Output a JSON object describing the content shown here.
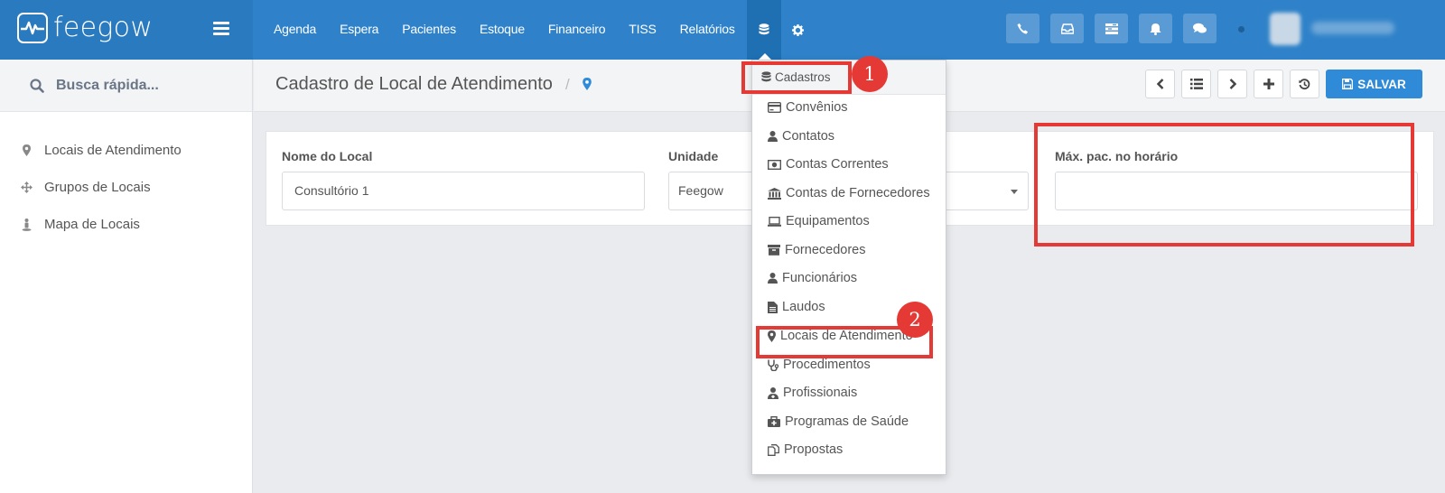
{
  "brand": {
    "name": "feegow"
  },
  "nav": {
    "items": [
      "Agenda",
      "Espera",
      "Pacientes",
      "Estoque",
      "Financeiro",
      "TISS",
      "Relatórios"
    ]
  },
  "sidebar": {
    "search_label": "Busca rápida...",
    "items": [
      {
        "label": "Locais de Atendimento",
        "icon": "map-marker-icon"
      },
      {
        "label": "Grupos de Locais",
        "icon": "arrows-icon"
      },
      {
        "label": "Mapa de Locais",
        "icon": "street-view-icon"
      }
    ]
  },
  "page": {
    "title": "Cadastro de Local de Atendimento",
    "breadcrumb_sep": "/",
    "save_label": "SALVAR"
  },
  "form": {
    "nome_label": "Nome do Local",
    "nome_value": "Consultório 1",
    "unidade_label": "Unidade",
    "unidade_value": "Feegow",
    "max_label": "Máx. pac. no horário",
    "max_value": ""
  },
  "dropdown": {
    "header": "Cadastros",
    "items": [
      {
        "label": "Convênios",
        "icon": "credit-card-icon"
      },
      {
        "label": "Contatos",
        "icon": "user-icon"
      },
      {
        "label": "Contas Correntes",
        "icon": "money-icon"
      },
      {
        "label": "Contas de Fornecedores",
        "icon": "bank-icon"
      },
      {
        "label": "Equipamentos",
        "icon": "laptop-icon"
      },
      {
        "label": "Fornecedores",
        "icon": "archive-icon"
      },
      {
        "label": "Funcionários",
        "icon": "user-icon"
      },
      {
        "label": "Laudos",
        "icon": "file-text-icon"
      },
      {
        "label": "Locais de Atendimento",
        "icon": "map-marker-icon"
      },
      {
        "label": "Procedimentos",
        "icon": "stethoscope-icon"
      },
      {
        "label": "Profissionais",
        "icon": "user-md-icon"
      },
      {
        "label": "Programas de Saúde",
        "icon": "medkit-icon"
      },
      {
        "label": "Propostas",
        "icon": "files-icon"
      }
    ]
  },
  "annotations": {
    "step1": "1",
    "step2": "2"
  },
  "colors": {
    "topbar": "#2f82c9",
    "accent": "#2f8ad8",
    "annotation": "#e53935"
  }
}
